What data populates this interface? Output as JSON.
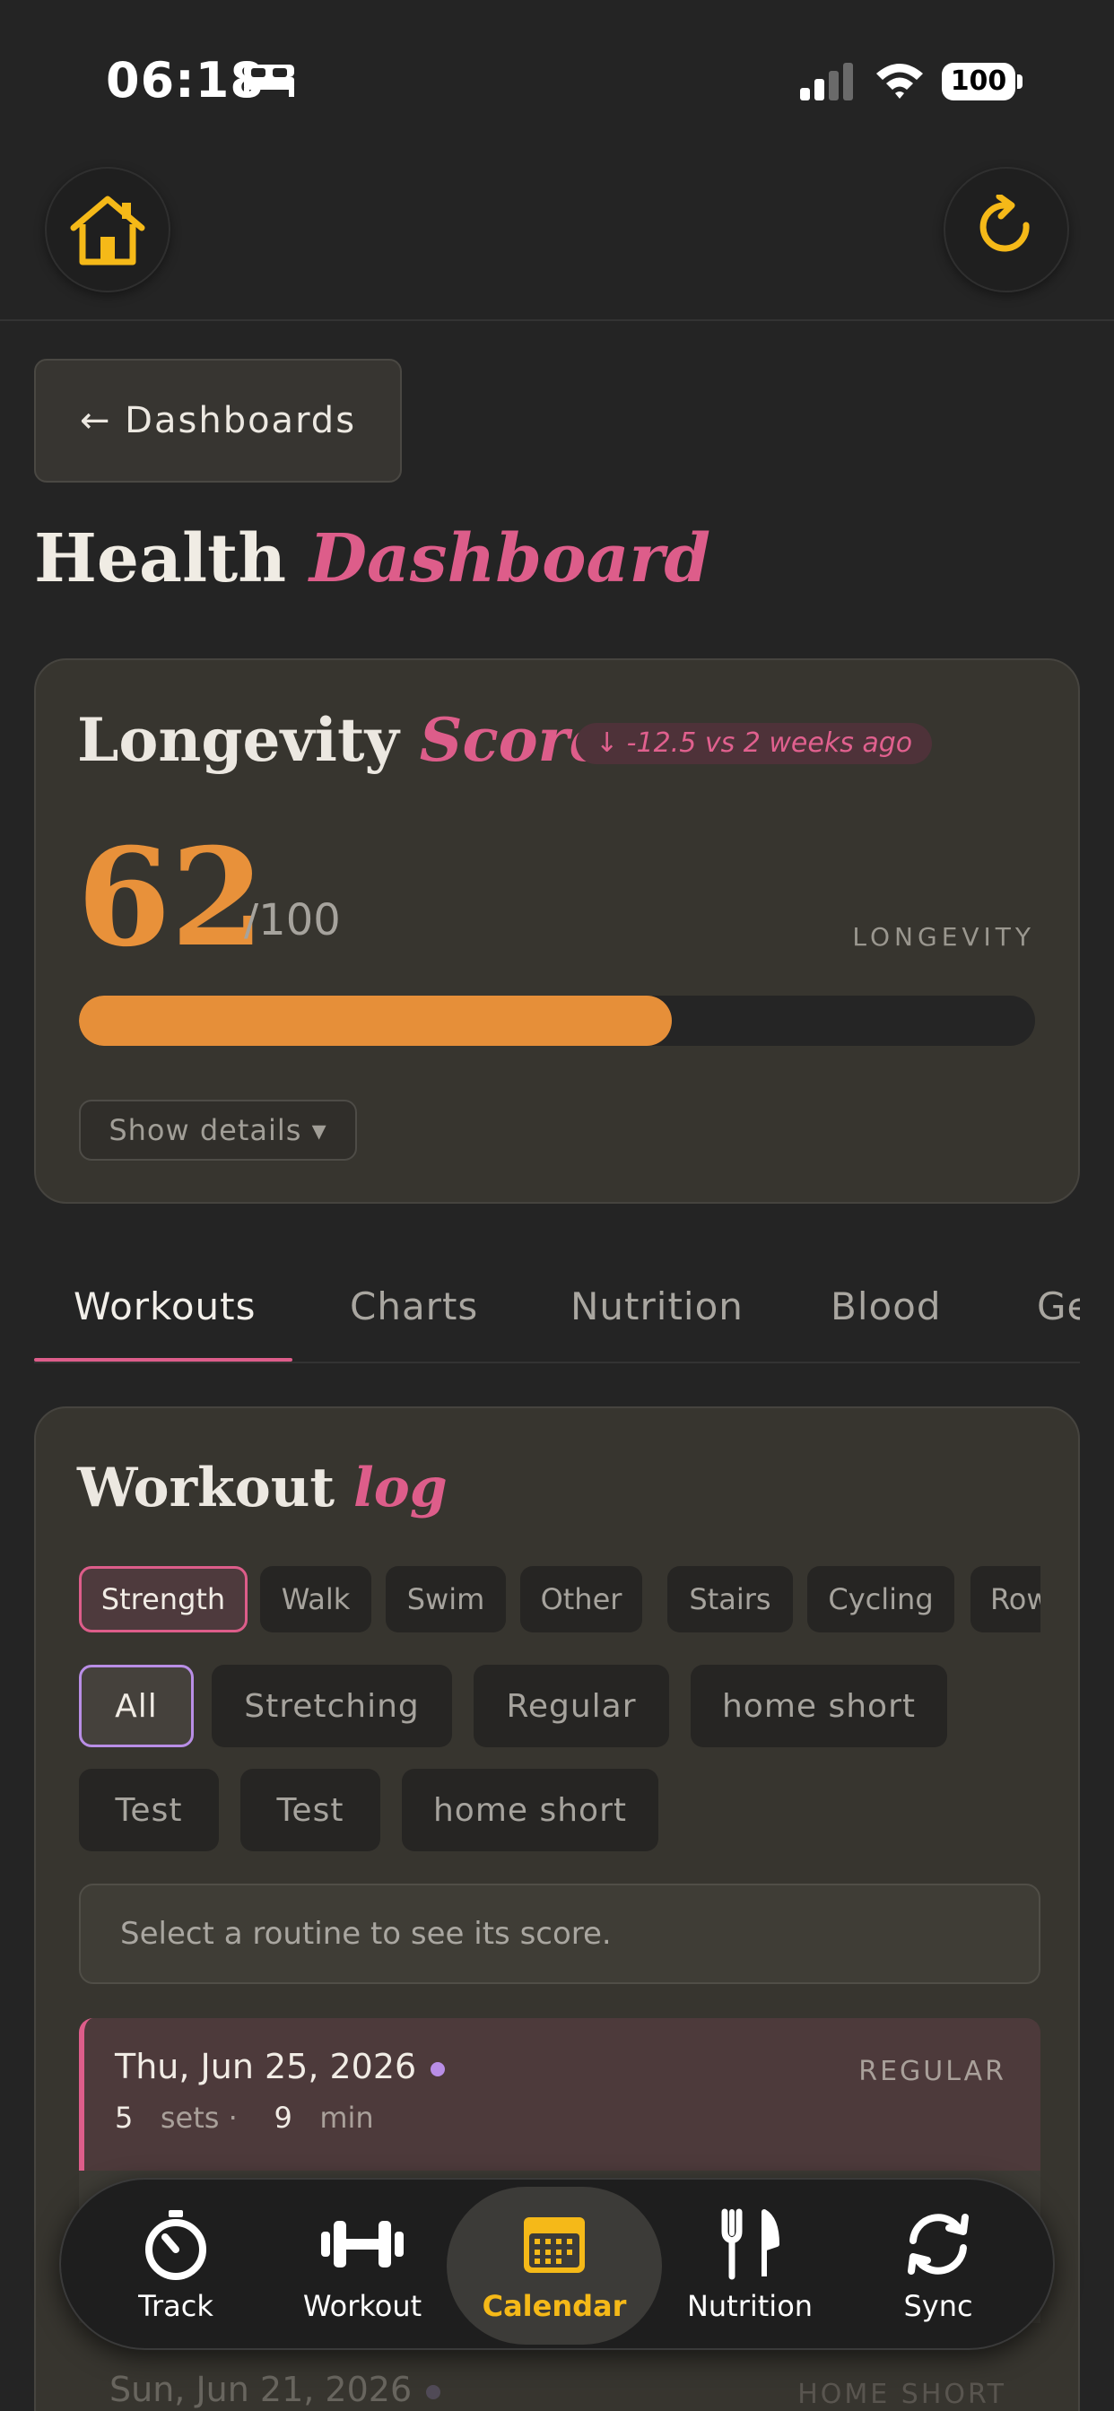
{
  "status": {
    "time": "06:18",
    "battery": "100"
  },
  "header": {
    "back_label": "← Dashboards",
    "title_main": "Health",
    "title_accent": "Dashboard"
  },
  "longevity": {
    "title_main": "Longevity",
    "title_accent": "Score",
    "delta": "↓ -12.5 vs 2 weeks ago",
    "value": "62",
    "max": "/100",
    "label": "LONGEVITY",
    "progress_percent": 62,
    "details_label": "Show details ▾"
  },
  "tabs": [
    {
      "label": "Workouts",
      "active": true
    },
    {
      "label": "Charts"
    },
    {
      "label": "Nutrition"
    },
    {
      "label": "Blood"
    },
    {
      "label": "Ge"
    }
  ],
  "workout_log": {
    "title_main": "Workout",
    "title_accent": "log",
    "types": [
      {
        "label": "Strength",
        "active": true
      },
      {
        "label": "Walk"
      },
      {
        "label": "Swim"
      },
      {
        "label": "Other"
      },
      {
        "label": "Stairs"
      },
      {
        "label": "Cycling"
      },
      {
        "label": "Row"
      }
    ],
    "routines": [
      {
        "label": "All",
        "active": true
      },
      {
        "label": "Stretching"
      },
      {
        "label": "Regular"
      },
      {
        "label": "home short"
      },
      {
        "label": "Test"
      },
      {
        "label": "Test"
      },
      {
        "label": "home short"
      }
    ],
    "hint": "Select a routine to see its score.",
    "entries": [
      {
        "date": "Thu, Jun 25, 2026",
        "tag": "REGULAR",
        "sets": "5",
        "sets_unit": "sets ·",
        "minutes": "9",
        "minutes_unit": "min"
      },
      {
        "date": "Sun, Jun 21, 2026",
        "tag": "HOME SHORT"
      }
    ]
  },
  "nav": [
    {
      "label": "Track",
      "icon": "timer-icon"
    },
    {
      "label": "Workout",
      "icon": "dumbbell-icon"
    },
    {
      "label": "Calendar",
      "icon": "calendar-icon",
      "active": true
    },
    {
      "label": "Nutrition",
      "icon": "fork-knife-icon"
    },
    {
      "label": "Sync",
      "icon": "sync-icon"
    }
  ],
  "colors": {
    "accent_pink": "#dd5d8a",
    "score_orange": "#e68f39",
    "home_gold": "#f5b918",
    "routine_purple": "#b98ee6"
  }
}
